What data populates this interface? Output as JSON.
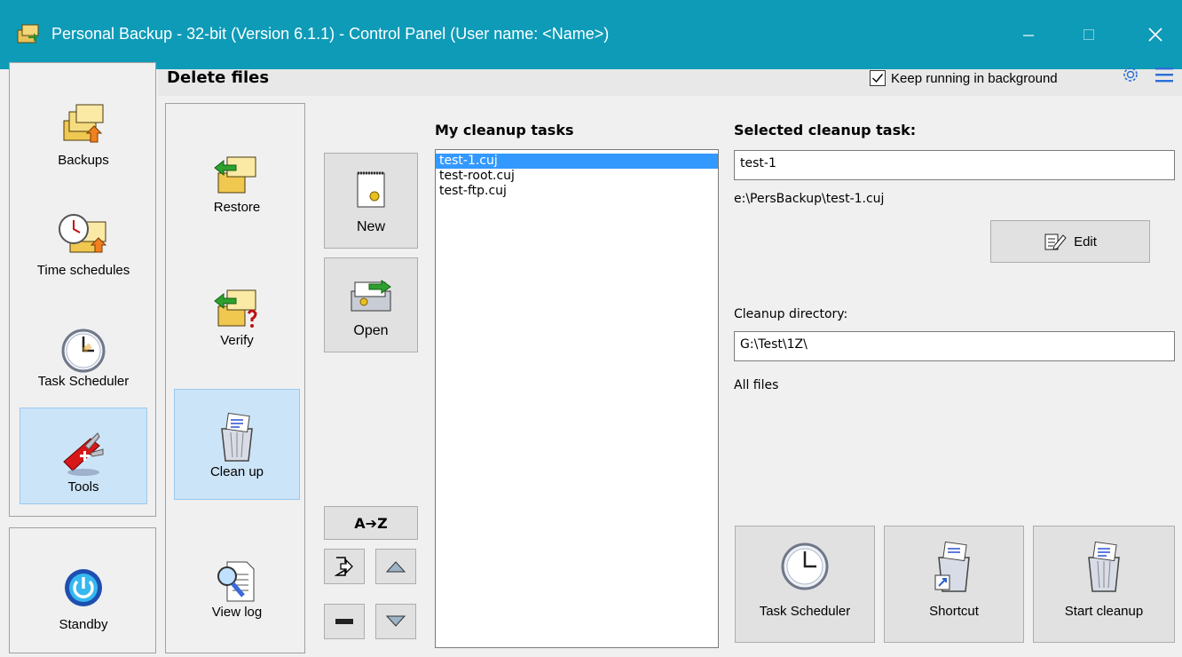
{
  "window": {
    "title": "Personal Backup - 32-bit (Version 6.1.1) - Control Panel (User name: <Name>)",
    "minimize_icon": "minimize-icon",
    "maximize_icon": "maximize-icon",
    "close_icon": "close-icon",
    "accent": "#0e9bb8"
  },
  "header": {
    "title": "Delete files",
    "keep_running_label": "Keep running in background",
    "keep_running_checked": true,
    "settings_icon": "gear-icon",
    "menu_icon": "hamburger-menu-icon"
  },
  "main_nav": {
    "items": [
      {
        "label": "Backups",
        "icon": "backups-icon"
      },
      {
        "label": "Time schedules",
        "icon": "time-schedules-icon"
      },
      {
        "label": "Task Scheduler",
        "icon": "clock-icon"
      },
      {
        "label": "Tools",
        "icon": "swiss-knife-icon",
        "selected": true
      }
    ],
    "standby": {
      "label": "Standby",
      "icon": "power-icon"
    }
  },
  "tools_nav": {
    "items": [
      {
        "label": "Restore",
        "icon": "restore-folder-icon"
      },
      {
        "label": "Verify",
        "icon": "verify-folder-icon"
      },
      {
        "label": "Clean up",
        "icon": "trash-bin-icon",
        "selected": true
      },
      {
        "label": "View log",
        "icon": "view-log-icon"
      }
    ]
  },
  "task_buttons": {
    "new_label": "New",
    "open_label": "Open",
    "sort_label": "A➔Z"
  },
  "cleanup_tasks": {
    "title": "My cleanup tasks",
    "items": [
      "test-1.cuj",
      "test-root.cuj",
      "test-ftp.cuj"
    ],
    "selected_index": 0
  },
  "selected_task": {
    "title": "Selected cleanup task:",
    "name": "test-1",
    "path": "e:\\PersBackup\\test-1.cuj",
    "edit_label": "Edit",
    "cleanup_dir_label": "Cleanup directory:",
    "cleanup_dir": "G:\\Test\\1Z\\",
    "filter_text": "All files"
  },
  "bottom_actions": {
    "task_scheduler_label": "Task Scheduler",
    "shortcut_label": "Shortcut",
    "start_cleanup_label": "Start cleanup"
  }
}
